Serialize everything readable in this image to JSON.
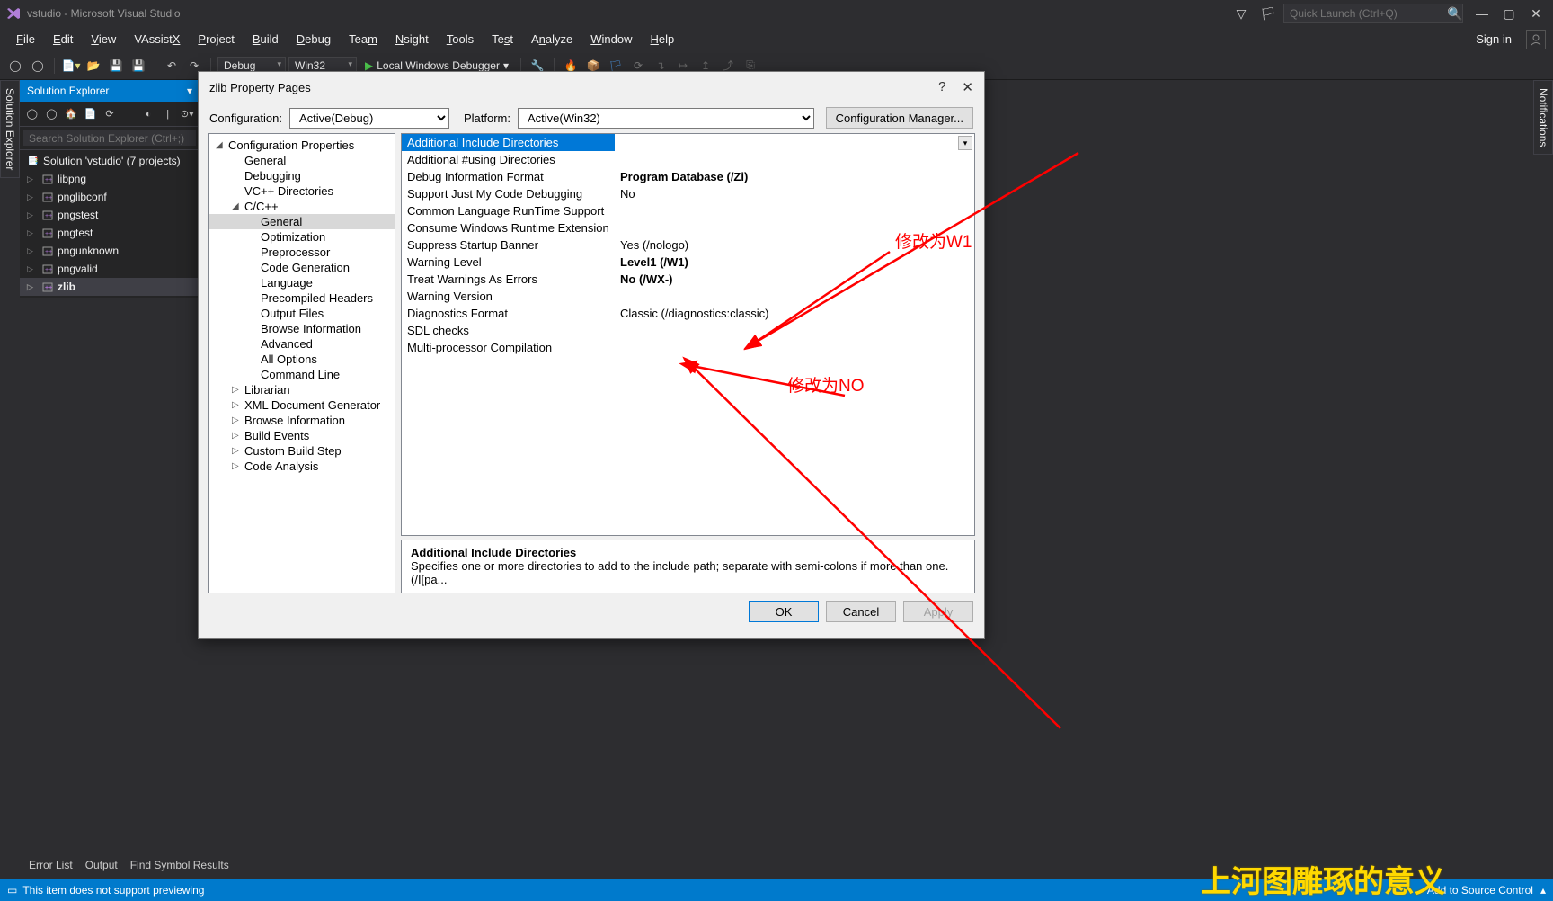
{
  "titlebar": {
    "title": "vstudio - Microsoft Visual Studio",
    "quick_launch_placeholder": "Quick Launch (Ctrl+Q)"
  },
  "menubar": {
    "items": [
      "File",
      "Edit",
      "View",
      "VAssistX",
      "Project",
      "Build",
      "Debug",
      "Team",
      "Nsight",
      "Tools",
      "Test",
      "Analyze",
      "Window",
      "Help"
    ],
    "sign_in": "Sign in"
  },
  "toolbar": {
    "config": "Debug",
    "platform": "Win32",
    "debugger": "Local Windows Debugger"
  },
  "side_tabs": {
    "left": "Solution Explorer",
    "right": "Notifications"
  },
  "solution_explorer": {
    "title": "Solution Explorer",
    "search_placeholder": "Search Solution Explorer (Ctrl+;)",
    "root": "Solution 'vstudio' (7 projects)",
    "projects": [
      "libpng",
      "pnglibconf",
      "pngstest",
      "pngtest",
      "pngunknown",
      "pngvalid",
      "zlib"
    ],
    "selected": "zlib"
  },
  "dialog": {
    "title": "zlib Property Pages",
    "config_label": "Configuration:",
    "config_value": "Active(Debug)",
    "platform_label": "Platform:",
    "platform_value": "Active(Win32)",
    "config_mgr": "Configuration Manager...",
    "tree": {
      "root": "Configuration Properties",
      "items": [
        "General",
        "Debugging",
        "VC++ Directories"
      ],
      "cpp": "C/C++",
      "cpp_items": [
        "General",
        "Optimization",
        "Preprocessor",
        "Code Generation",
        "Language",
        "Precompiled Headers",
        "Output Files",
        "Browse Information",
        "Advanced",
        "All Options",
        "Command Line"
      ],
      "others": [
        "Librarian",
        "XML Document Generator",
        "Browse Information",
        "Build Events",
        "Custom Build Step",
        "Code Analysis"
      ]
    },
    "grid": [
      {
        "name": "Additional Include Directories",
        "val": "",
        "sel": true
      },
      {
        "name": "Additional #using Directories",
        "val": ""
      },
      {
        "name": "Debug Information Format",
        "val": "Program Database (/Zi)",
        "bold": true
      },
      {
        "name": "Support Just My Code Debugging",
        "val": "No"
      },
      {
        "name": "Common Language RunTime Support",
        "val": ""
      },
      {
        "name": "Consume Windows Runtime Extension",
        "val": ""
      },
      {
        "name": "Suppress Startup Banner",
        "val": "Yes (/nologo)"
      },
      {
        "name": "Warning Level",
        "val": "Level1 (/W1)",
        "bold": true
      },
      {
        "name": "Treat Warnings As Errors",
        "val": "No (/WX-)",
        "bold": true
      },
      {
        "name": "Warning Version",
        "val": ""
      },
      {
        "name": "Diagnostics Format",
        "val": "Classic (/diagnostics:classic)"
      },
      {
        "name": "SDL checks",
        "val": ""
      },
      {
        "name": "Multi-processor Compilation",
        "val": ""
      }
    ],
    "desc": {
      "title": "Additional Include Directories",
      "text": "Specifies one or more directories to add to the include path; separate with semi-colons if more than one.     (/I[pa..."
    },
    "buttons": {
      "ok": "OK",
      "cancel": "Cancel",
      "apply": "Apply"
    }
  },
  "bottom_tabs": [
    "Error List",
    "Output",
    "Find Symbol Results"
  ],
  "statusbar": {
    "msg": "This item does not support previewing",
    "source_control": "Add to Source Control"
  },
  "annotations": {
    "w1": "修改为W1",
    "no": "修改为NO"
  },
  "watermark": "上河图雕琢的意义"
}
